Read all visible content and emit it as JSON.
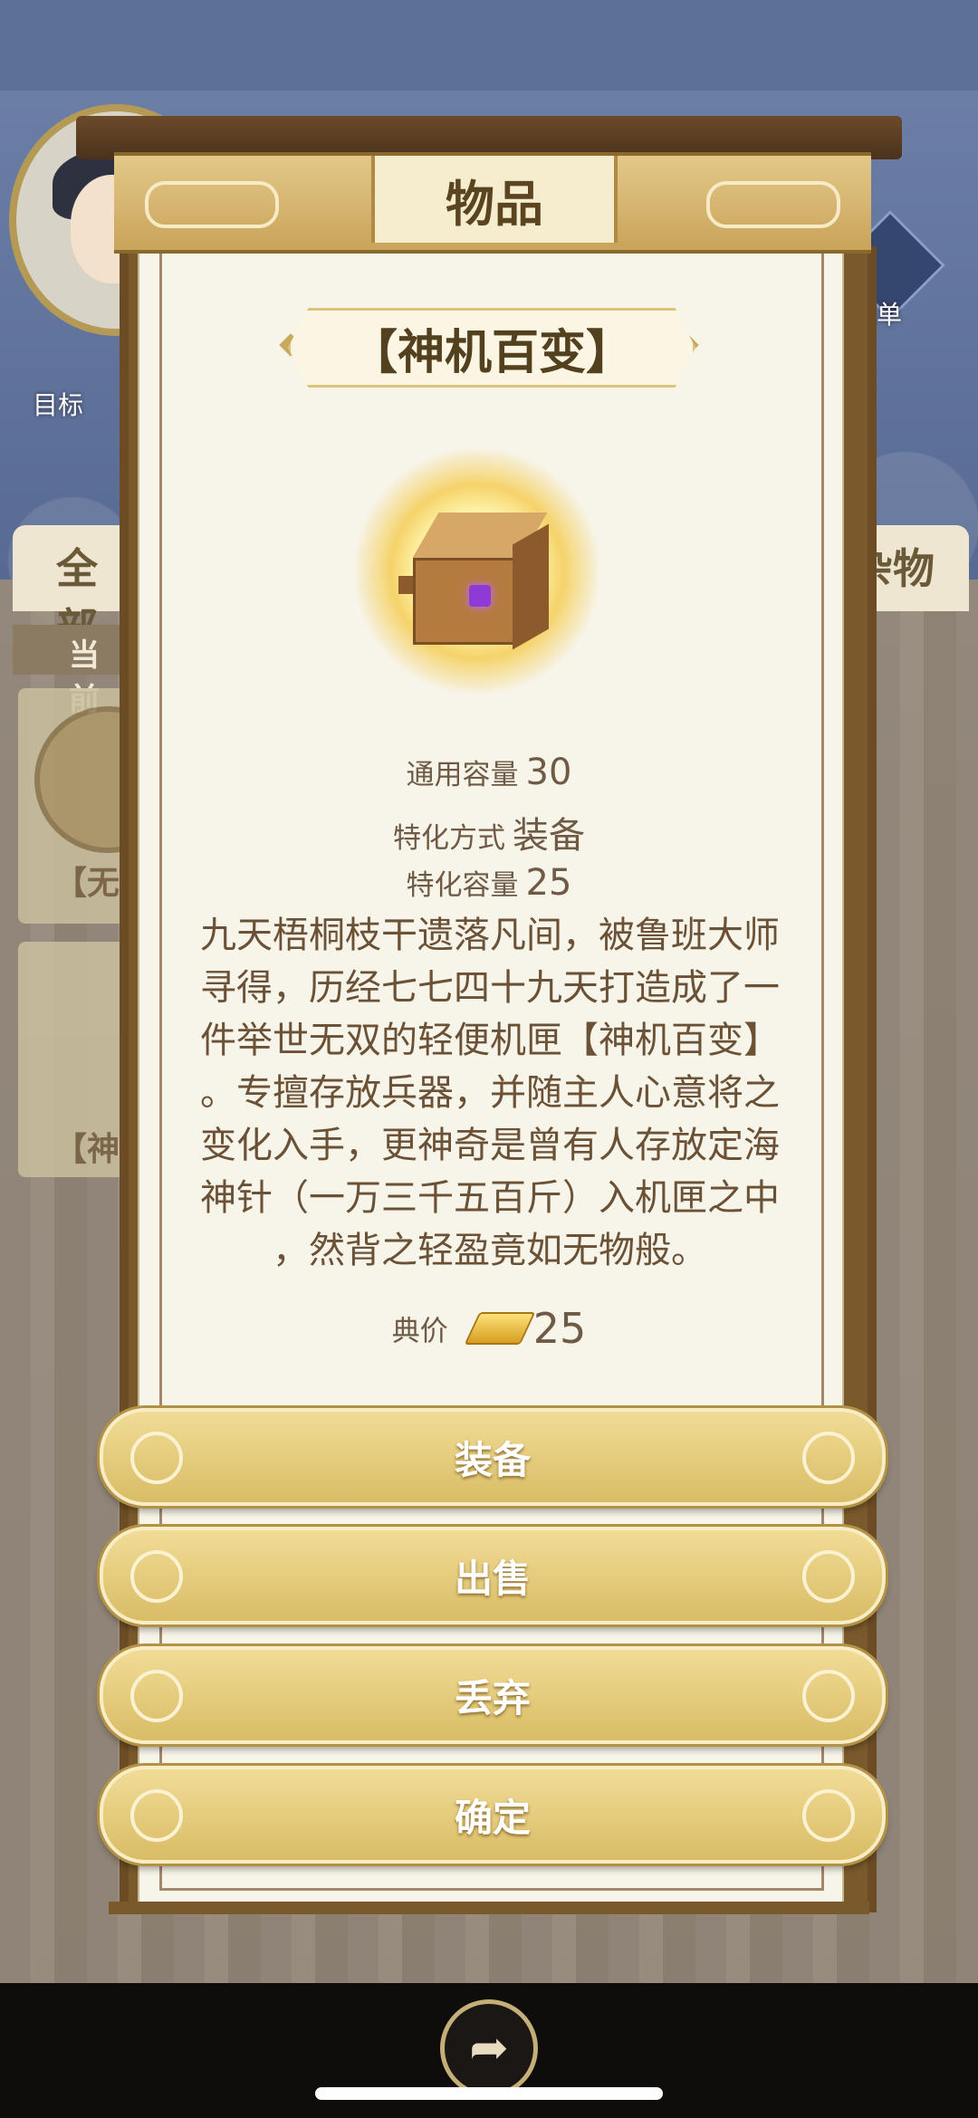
{
  "header": {
    "title": "物品"
  },
  "background": {
    "goal_label": "目标",
    "menu_label": "菜单",
    "tab_all": "全部",
    "tab_misc": "杂物",
    "current_label": "当前",
    "slot1_label": "【无",
    "slot2_label": "【神"
  },
  "item": {
    "name": "【神机百变】",
    "general_capacity_label": "通用容量",
    "general_capacity_value": "30",
    "special_mode_label": "特化方式",
    "special_mode_value": "装备",
    "special_capacity_label": "特化容量",
    "special_capacity_value": "25",
    "description": [
      "九天梧桐枝干遗落凡间，被鲁班大师",
      "寻得，历经七七四十九天打造成了一",
      "件举世无双的轻便机匣【神机百变】",
      "。专擅存放兵器，并随主人心意将之",
      "变化入手，更神奇是曾有人存放定海",
      "神针（一万三千五百斤）入机匣之中",
      "，然背之轻盈竟如无物般。"
    ],
    "price_label": "典价",
    "price_value": "25"
  },
  "actions": {
    "equip": "装备",
    "sell": "出售",
    "discard": "丢弃",
    "confirm": "确定"
  },
  "icons": {
    "price": "gold-ingot-icon",
    "share": "share-icon"
  },
  "colors": {
    "panel_bg": "#f7f4ea",
    "button_gold": "#d9bc66",
    "text_brown": "#6b5135"
  }
}
